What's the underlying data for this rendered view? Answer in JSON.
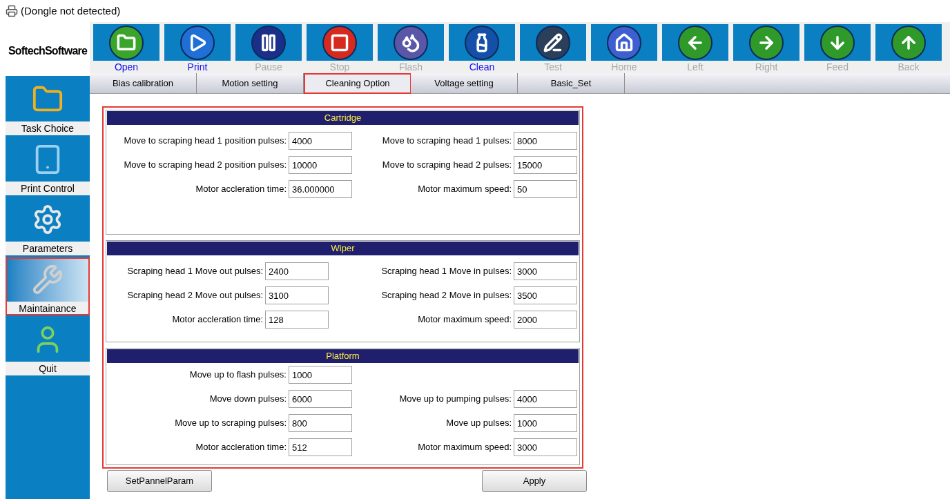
{
  "window": {
    "title": "(Dongle not detected)"
  },
  "logo": {
    "text": "SoftechSoftware"
  },
  "toolbar": [
    {
      "label": "Open",
      "kind": "open",
      "disabled": false
    },
    {
      "label": "Print",
      "kind": "print",
      "disabled": false
    },
    {
      "label": "Pause",
      "kind": "pause",
      "disabled": true
    },
    {
      "label": "Stop",
      "kind": "stop",
      "disabled": true
    },
    {
      "label": "Flash",
      "kind": "flash",
      "disabled": true
    },
    {
      "label": "Clean",
      "kind": "clean",
      "disabled": false
    },
    {
      "label": "Test",
      "kind": "test",
      "disabled": true
    },
    {
      "label": "Home",
      "kind": "home",
      "disabled": true
    },
    {
      "label": "Left",
      "kind": "left",
      "disabled": true
    },
    {
      "label": "Right",
      "kind": "right",
      "disabled": true
    },
    {
      "label": "Feed",
      "kind": "feed",
      "disabled": true
    },
    {
      "label": "Back",
      "kind": "back",
      "disabled": true
    }
  ],
  "tabs": [
    {
      "label": "Bias calibration",
      "selected": false
    },
    {
      "label": "Motion setting",
      "selected": false
    },
    {
      "label": "Cleaning Option",
      "selected": true
    },
    {
      "label": "Voltage setting",
      "selected": false
    },
    {
      "label": "Basic_Set",
      "selected": false
    }
  ],
  "sidebar": {
    "items": [
      {
        "label": "Task Choice",
        "kind": "folder",
        "selected": false
      },
      {
        "label": "Print Control",
        "kind": "panel",
        "selected": false
      },
      {
        "label": "Parameters",
        "kind": "gear",
        "selected": false
      },
      {
        "label": "Maintainance",
        "kind": "tools",
        "selected": true
      },
      {
        "label": "Quit",
        "kind": "user",
        "selected": false
      }
    ]
  },
  "sections": [
    {
      "title": "Cartridge",
      "rows": [
        {
          "left": {
            "label": "Move to scraping head 1 position pulses:",
            "value": "4000"
          },
          "right": {
            "label": "Move to scraping head 1 pulses:",
            "value": "8000"
          }
        },
        {
          "left": {
            "label": "Move to scraping head 2 position pulses:",
            "value": "10000"
          },
          "right": {
            "label": "Move to scraping head 2 pulses:",
            "value": "15000"
          }
        },
        {
          "left": {
            "label": "Motor accleration time:",
            "value": "36.000000"
          },
          "right": {
            "label": "Motor maximum speed:",
            "value": "50"
          }
        }
      ]
    },
    {
      "title": "Wiper",
      "rows": [
        {
          "left": {
            "label": "Scraping head 1 Move out pulses:",
            "value": "2400"
          },
          "right": {
            "label": "Scraping head 1 Move in pulses:",
            "value": "3000"
          }
        },
        {
          "left": {
            "label": "Scraping head 2 Move out pulses:",
            "value": "3100"
          },
          "right": {
            "label": "Scraping head 2 Move in pulses:",
            "value": "3500"
          }
        },
        {
          "left": {
            "label": "Motor accleration time:",
            "value": "128"
          },
          "right": {
            "label": "Motor maximum speed:",
            "value": "2000"
          }
        }
      ]
    },
    {
      "title": "Platform",
      "rows": [
        {
          "left": {
            "label": "Move up to flash pulses:",
            "value": "1000"
          }
        },
        {
          "left": {
            "label": "Move down pulses:",
            "value": "6000"
          },
          "right": {
            "label": "Move up to pumping pulses:",
            "value": "4000"
          }
        },
        {
          "left": {
            "label": "Move up to scraping pulses:",
            "value": "800"
          },
          "right": {
            "label": "Move up pulses:",
            "value": "1000"
          }
        },
        {
          "left": {
            "label": "Motor accleration time:",
            "value": "512"
          },
          "right": {
            "label": "Motor maximum speed:",
            "value": "3000"
          }
        }
      ]
    }
  ],
  "buttons": [
    "SetPannelParam",
    "Apply"
  ]
}
